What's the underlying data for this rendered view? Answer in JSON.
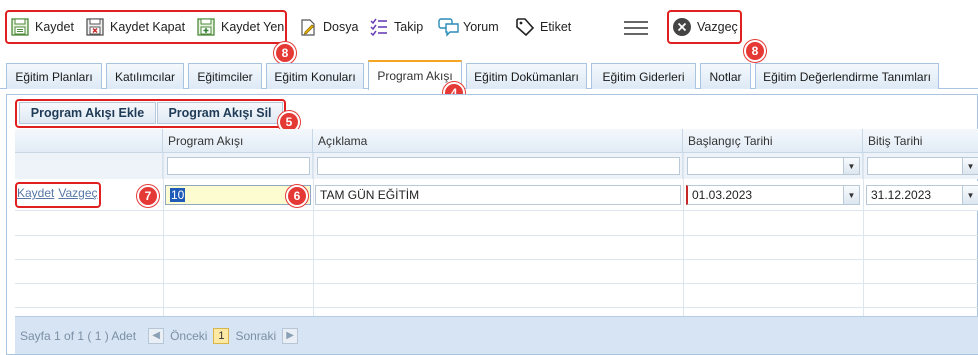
{
  "toolbar": {
    "save": "Kaydet",
    "save_close": "Kaydet Kapat",
    "save_new": "Kaydet Yeni",
    "file": "Dosya",
    "follow": "Takip",
    "comment": "Yorum",
    "tag": "Etiket",
    "cancel": "Vazgeç"
  },
  "tabs": [
    {
      "label": "Eğitim Planları"
    },
    {
      "label": "Katılımcılar"
    },
    {
      "label": "Eğitimciler"
    },
    {
      "label": "Eğitim Konuları"
    },
    {
      "label": "Program Akışı",
      "active": true
    },
    {
      "label": "Eğitim Dokümanları"
    },
    {
      "label": "Eğitim Giderleri"
    },
    {
      "label": "Notlar"
    },
    {
      "label": "Eğitim Değerlendirme Tanımları"
    }
  ],
  "subtoolbar": {
    "add": "Program Akışı Ekle",
    "delete": "Program Akışı Sil"
  },
  "grid": {
    "headers": {
      "flow": "Program Akışı",
      "description": "Açıklama",
      "start_date": "Başlangıç Tarihi",
      "end_date": "Bitiş Tarihi"
    },
    "edit_row": {
      "save_link": "Kaydet",
      "cancel_link": "Vazgeç",
      "flow_value": "10",
      "description_value": "TAM GÜN EĞİTİM",
      "start_date_value": "01.03.2023",
      "end_date_value": "31.12.2023"
    }
  },
  "pager": {
    "summary": "Sayfa 1 of 1 ( 1 ) Adet",
    "prev": "Önceki",
    "page": "1",
    "next": "Sonraki"
  },
  "annotations": {
    "b8a": "8",
    "b8b": "8",
    "b4": "4",
    "b5": "5",
    "b7": "7",
    "b6": "6"
  },
  "colors": {
    "annotation_red": "#e53935",
    "active_tab_accent": "#f5a623",
    "grid_border": "#a9c4e0"
  }
}
